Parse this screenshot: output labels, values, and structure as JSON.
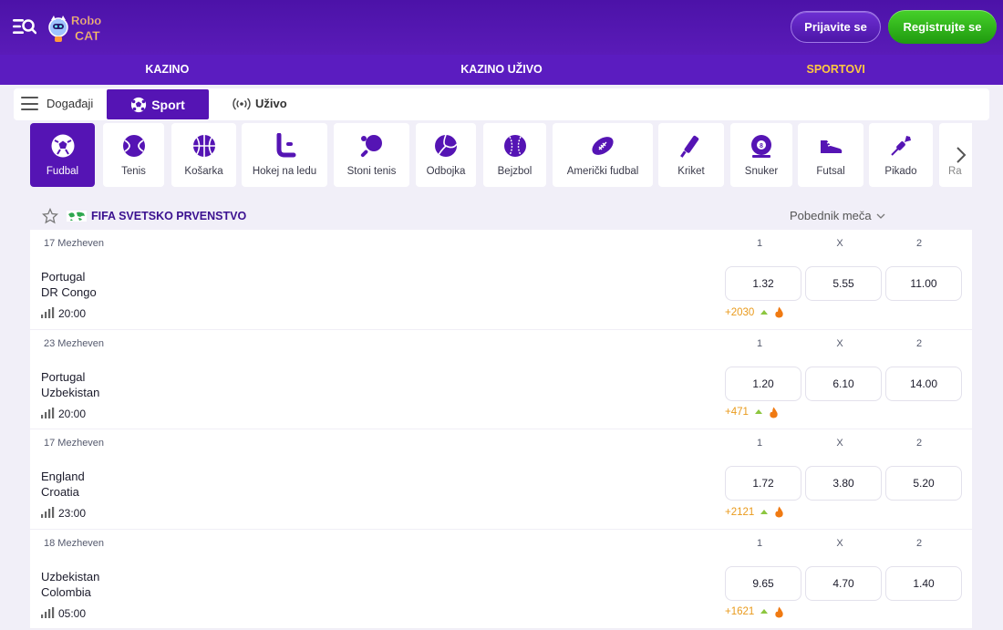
{
  "header": {
    "logo_text_line1": "Robo",
    "logo_text_line2": "CAT",
    "login_label": "Prijavite se",
    "register_label": "Registrujte se"
  },
  "nav": [
    {
      "label": "KAZINO",
      "active": false
    },
    {
      "label": "KAZINO UŽIVO",
      "active": false
    },
    {
      "label": "SPORTOVI",
      "active": true
    }
  ],
  "subtabs": {
    "events_label": "Događaji",
    "sport_label": "Sport",
    "live_label": "Uživo"
  },
  "sports": [
    {
      "label": "Fudbal",
      "icon": "soccer-ball-icon",
      "active": true
    },
    {
      "label": "Tenis",
      "icon": "tennis-ball-icon"
    },
    {
      "label": "Košarka",
      "icon": "basketball-icon"
    },
    {
      "label": "Hokej na ledu",
      "icon": "hockey-stick-icon"
    },
    {
      "label": "Stoni tenis",
      "icon": "table-tennis-icon"
    },
    {
      "label": "Odbojka",
      "icon": "volleyball-icon"
    },
    {
      "label": "Bejzbol",
      "icon": "baseball-icon"
    },
    {
      "label": "Američki fudbal",
      "icon": "american-football-icon"
    },
    {
      "label": "Kriket",
      "icon": "cricket-bat-icon"
    },
    {
      "label": "Snuker",
      "icon": "snooker-ball-icon"
    },
    {
      "label": "Futsal",
      "icon": "sneaker-icon"
    },
    {
      "label": "Pikado",
      "icon": "dart-icon"
    },
    {
      "label": "Ra",
      "icon": "partial-icon"
    }
  ],
  "league": {
    "title": "FIFA SVETSKO PRVENSTVO",
    "market": "Pobednik meča",
    "columns": [
      "1",
      "X",
      "2"
    ]
  },
  "events": [
    {
      "date": "17 Mezheven",
      "home": "Portugal",
      "away": "DR Congo",
      "time": "20:00",
      "odds": [
        "1.32",
        "5.55",
        "11.00"
      ],
      "more": "+2030"
    },
    {
      "date": "23 Mezheven",
      "home": "Portugal",
      "away": "Uzbekistan",
      "time": "20:00",
      "odds": [
        "1.20",
        "6.10",
        "14.00"
      ],
      "more": "+471"
    },
    {
      "date": "17 Mezheven",
      "home": "England",
      "away": "Croatia",
      "time": "23:00",
      "odds": [
        "1.72",
        "3.80",
        "5.20"
      ],
      "more": "+2121"
    },
    {
      "date": "18 Mezheven",
      "home": "Uzbekistan",
      "away": "Colombia",
      "time": "05:00",
      "odds": [
        "9.65",
        "4.70",
        "1.40"
      ],
      "more": "+1621"
    }
  ],
  "colors": {
    "primary": "#5514b4",
    "header": "#4c12a8",
    "accent_gold": "#ffc940",
    "register_green": "#2fb81a",
    "more_orange": "#e99a1c"
  }
}
